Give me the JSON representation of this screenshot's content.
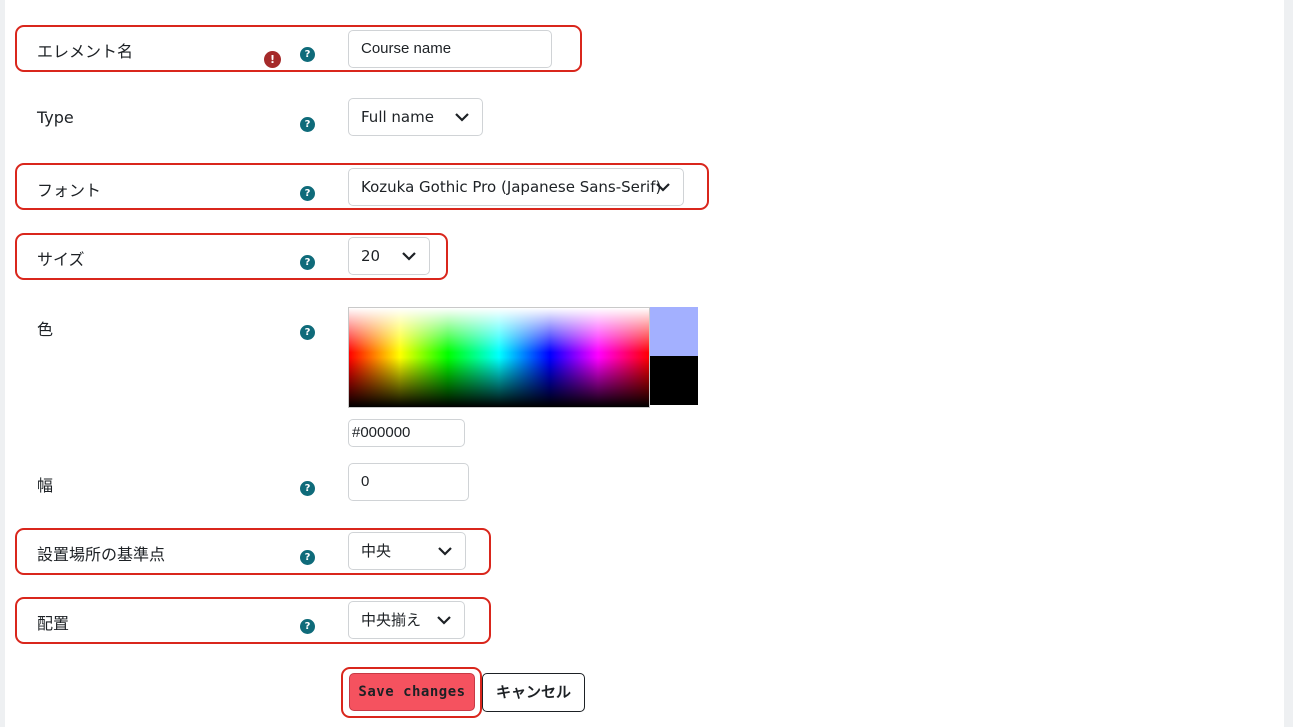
{
  "form": {
    "element_name": {
      "label": "エレメント名",
      "value": "Course name"
    },
    "type": {
      "label": "Type",
      "value": "Full name"
    },
    "font": {
      "label": "フォント",
      "value": "Kozuka Gothic Pro (Japanese Sans-Serif)"
    },
    "size": {
      "label": "サイズ",
      "value": "20"
    },
    "color": {
      "label": "色",
      "value": "#000000",
      "preview_top_color": "#a3b0ff",
      "preview_bottom_color": "#000000"
    },
    "width": {
      "label": "幅",
      "value": "0"
    },
    "anchor": {
      "label": "設置場所の基準点",
      "value": "中央"
    },
    "alignment": {
      "label": "配置",
      "value": "中央揃え"
    }
  },
  "icons": {
    "help": "?",
    "error": "!"
  },
  "buttons": {
    "save": "Save changes",
    "cancel": "キャンセル"
  },
  "colors": {
    "highlight": "#d9261c",
    "help_icon": "#0f6b7a",
    "error_icon": "#a52a2a",
    "save_button": "#f5525f"
  }
}
